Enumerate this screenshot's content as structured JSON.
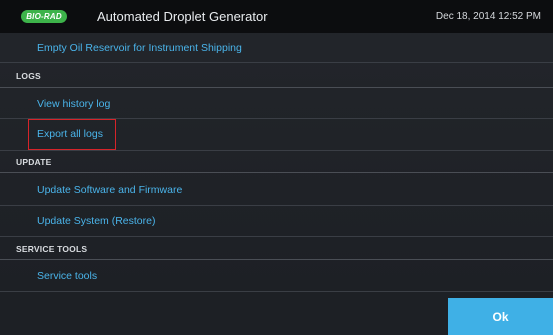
{
  "header": {
    "logo_text": "BIO-RAD",
    "title": "Automated Droplet Generator",
    "datetime": "Dec 18, 2014 12:52 PM"
  },
  "list": {
    "empty_oil": "Empty Oil Reservoir for Instrument Shipping",
    "sections": {
      "logs": "LOGS",
      "update": "UPDATE",
      "service_tools": "SERVICE TOOLS"
    },
    "items": {
      "view_history_log": "View history log",
      "export_all_logs": "Export all logs",
      "update_software": "Update Software and Firmware",
      "update_system": "Update System (Restore)",
      "service_tools": "Service tools"
    }
  },
  "footer": {
    "ok_label": "Ok"
  },
  "colors": {
    "link_blue": "#4ab4ea",
    "ok_button": "#3fb0e6",
    "logo_green": "#3db34a",
    "highlight_red": "#d6242a"
  }
}
